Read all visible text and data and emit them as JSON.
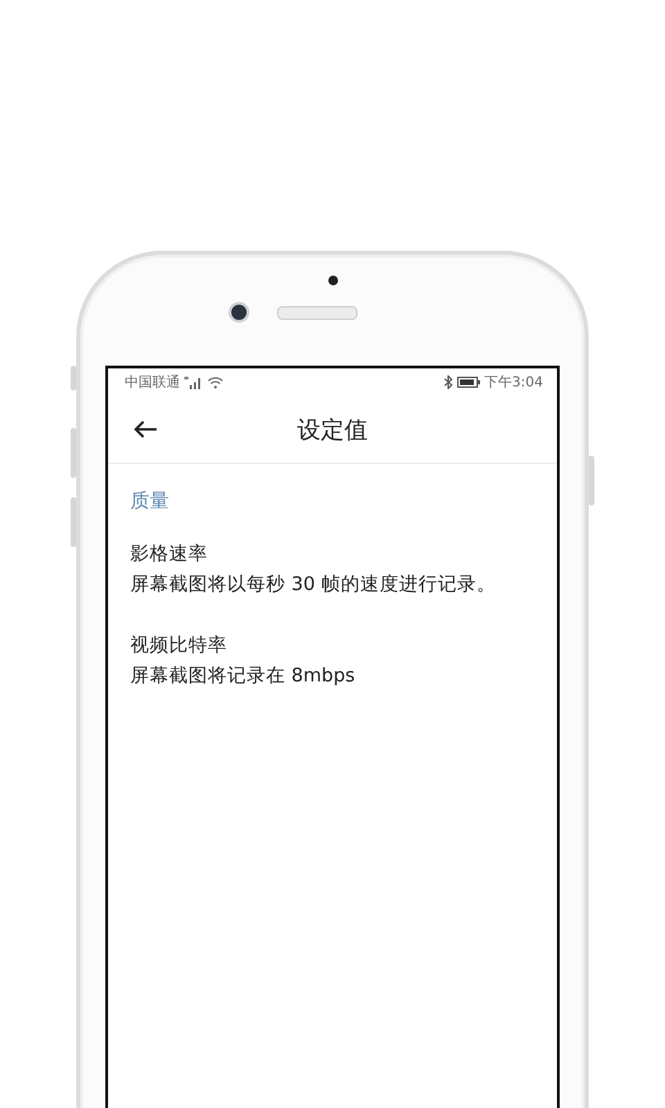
{
  "status_bar": {
    "carrier": "中国联通",
    "time": "下午3:04"
  },
  "header": {
    "title": "设定值"
  },
  "section": {
    "title": "质量"
  },
  "settings": [
    {
      "title": "影格速率",
      "description": "屏幕截图将以每秒 30 帧的速度进行记录。"
    },
    {
      "title": "视频比特率",
      "description": "屏幕截图将记录在 8mbps"
    }
  ]
}
